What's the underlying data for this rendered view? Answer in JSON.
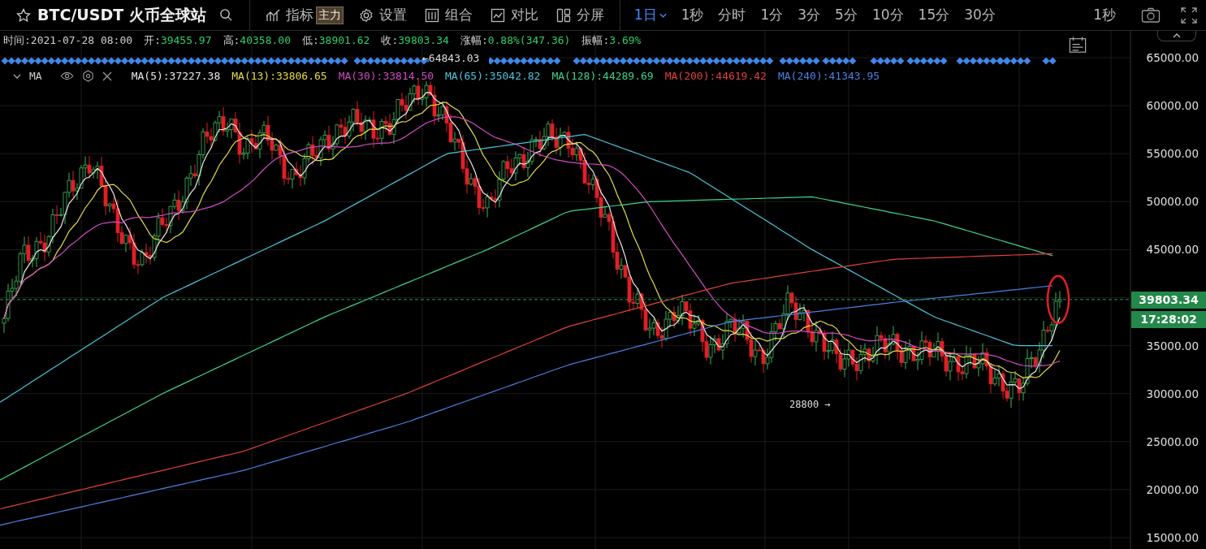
{
  "header": {
    "symbol": "BTC/USDT 火币全球站",
    "tools": [
      {
        "kind": "indicator",
        "label": "指标",
        "badge": "主力"
      },
      {
        "kind": "settings",
        "label": "设置"
      },
      {
        "kind": "combo",
        "label": "组合"
      },
      {
        "kind": "compare",
        "label": "对比"
      },
      {
        "kind": "split",
        "label": "分屏"
      }
    ],
    "intervals": [
      {
        "label": "1日",
        "selected": true
      },
      {
        "label": "1秒",
        "selected": false
      },
      {
        "label": "分时",
        "selected": false
      },
      {
        "label": "1分",
        "selected": false
      },
      {
        "label": "3分",
        "selected": false
      },
      {
        "label": "5分",
        "selected": false
      },
      {
        "label": "10分",
        "selected": false
      },
      {
        "label": "15分",
        "selected": false
      },
      {
        "label": "30分",
        "selected": false
      }
    ],
    "right_interval": "1秒"
  },
  "ohlc": [
    {
      "label": "时间:",
      "value": "2021-07-28 08:00",
      "color": "#d0d0d0"
    },
    {
      "label": "开:",
      "value": "39455.97",
      "color": "#2fcf6a"
    },
    {
      "label": "高:",
      "value": "40358.00",
      "color": "#2fcf6a"
    },
    {
      "label": "低:",
      "value": "38901.62",
      "color": "#2fcf6a"
    },
    {
      "label": "收:",
      "value": "39803.34",
      "color": "#2fcf6a"
    },
    {
      "label": "涨幅:",
      "value": "0.88%(347.36)",
      "color": "#2fcf6a"
    },
    {
      "label": "振幅:",
      "value": "3.69%",
      "color": "#2fcf6a"
    }
  ],
  "indicator": {
    "name": "MA",
    "lines": [
      {
        "text": "MA(5):37227.38",
        "color": "#e8e8e8"
      },
      {
        "text": "MA(13):33806.65",
        "color": "#e6dc45"
      },
      {
        "text": "MA(30):33814.50",
        "color": "#d24cc4"
      },
      {
        "text": "MA(65):35042.82",
        "color": "#4cc4dc"
      },
      {
        "text": "MA(128):44289.69",
        "color": "#3fd28a"
      },
      {
        "text": "MA(200):44619.42",
        "color": "#e0413c"
      },
      {
        "text": "MA(240):41343.95",
        "color": "#4a80e0"
      }
    ]
  },
  "chart": {
    "y_axis": [
      "65000.00",
      "60000.00",
      "55000.00",
      "50000.00",
      "45000.00",
      "35000.00",
      "30000.00",
      "25000.00",
      "20000.00",
      "15000.00"
    ],
    "last_price": "39803.34",
    "countdown": "17:28:02",
    "high_marker": "←64843.03",
    "low_marker": "28800 →"
  }
}
